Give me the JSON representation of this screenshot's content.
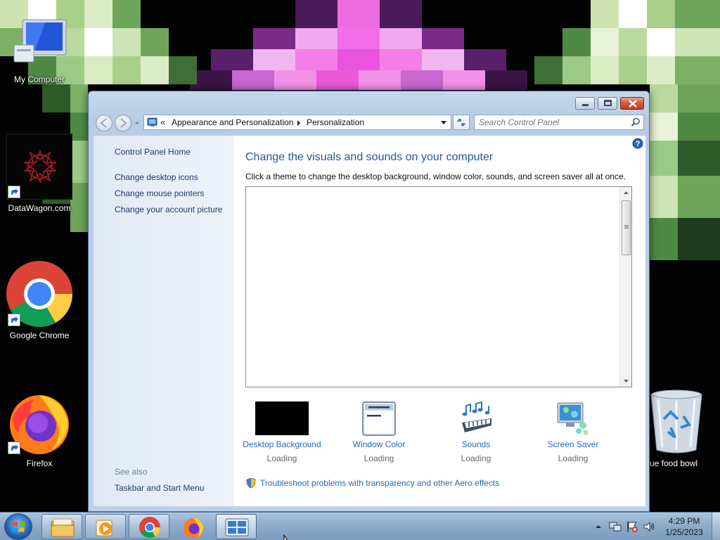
{
  "desktop": {
    "icons": [
      {
        "label": "My Computer"
      },
      {
        "label": "DataWagon.com"
      },
      {
        "label": "Google Chrome"
      },
      {
        "label": "Firefox"
      },
      {
        "label": "rue food bowl"
      }
    ]
  },
  "window": {
    "breadcrumb": {
      "overflow": "«",
      "segments": [
        "Appearance and Personalization",
        "Personalization"
      ]
    },
    "search_placeholder": "Search Control Panel",
    "sidebar": {
      "home": "Control Panel Home",
      "links": [
        "Change desktop icons",
        "Change mouse pointers",
        "Change your account picture"
      ],
      "see_also_heading": "See also",
      "see_also_links": [
        "Taskbar and Start Menu"
      ]
    },
    "main": {
      "heading": "Change the visuals and sounds on your computer",
      "description": "Click a theme to change the desktop background, window color, sounds, and screen saver all at once.",
      "tiles": [
        {
          "label": "Desktop Background",
          "status": "Loading"
        },
        {
          "label": "Window Color",
          "status": "Loading"
        },
        {
          "label": "Sounds",
          "status": "Loading"
        },
        {
          "label": "Screen Saver",
          "status": "Loading"
        }
      ],
      "troubleshoot_link": "Troubleshoot problems with transparency and other Aero effects"
    }
  },
  "taskbar": {
    "clock": {
      "time": "4:29 PM",
      "date": "1/25/2023"
    }
  },
  "colors": {
    "heading_blue": "#1e5aa8",
    "link_blue": "#1f6bc1",
    "sidebar_link": "#1e3d6b"
  }
}
